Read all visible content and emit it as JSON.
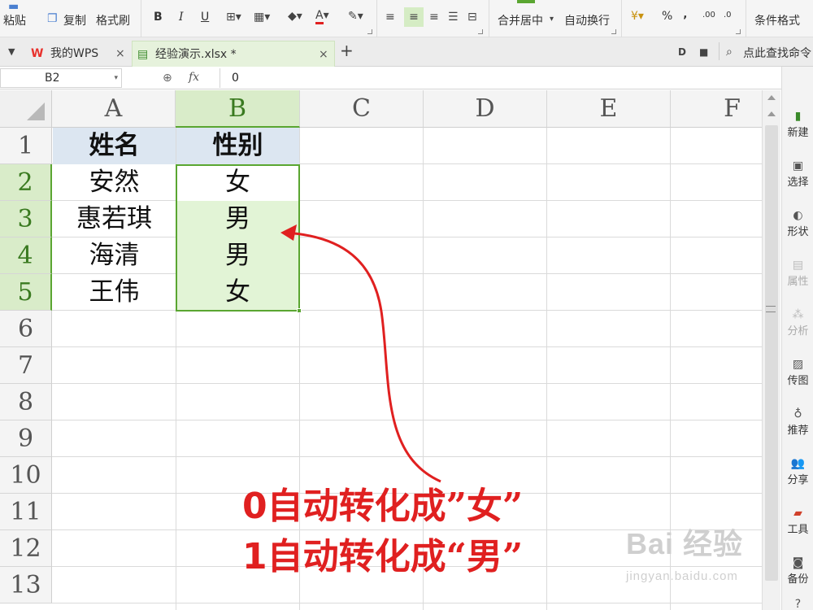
{
  "ribbon": {
    "paste_label": "粘贴",
    "copy_label": "复制",
    "format_painter_label": "格式刷",
    "bold": "B",
    "italic": "I",
    "underline": "U",
    "merge_center_label": "合并居中",
    "wrap_text_label": "自动换行",
    "percent": "%",
    "comma": "‚",
    "decimal_inc": ".00",
    "decimal_dec": ".0",
    "conditional_format_label": "条件格式"
  },
  "tabs": {
    "home_tab": "我的WPS",
    "file_tab": "经验演示.xlsx *",
    "new_tab_icon": "+",
    "search_label": "点此查找命令"
  },
  "formula_bar": {
    "cell_ref": "B2",
    "fx_label": "fx",
    "formula_value": "0"
  },
  "sheet": {
    "columns": [
      "A",
      "B",
      "C",
      "D",
      "E",
      "F"
    ],
    "rows": [
      "1",
      "2",
      "3",
      "4",
      "5",
      "6",
      "7",
      "8",
      "9",
      "10",
      "11",
      "12",
      "13"
    ],
    "header": [
      "姓名",
      "性别"
    ],
    "data": [
      [
        "安然",
        "女"
      ],
      [
        "惠若琪",
        "男"
      ],
      [
        "海清",
        "男"
      ],
      [
        "王伟",
        "女"
      ]
    ],
    "selected_column": "B",
    "selected_rows": [
      "2",
      "3",
      "4",
      "5"
    ]
  },
  "side_panel": {
    "items": [
      "新建",
      "选择",
      "形状",
      "属性",
      "分析",
      "传图",
      "推荐",
      "分享",
      "工具",
      "备份"
    ]
  },
  "annotation": {
    "line1_prefix": "0",
    "line1_text": "自动转化成”女”",
    "line2_prefix": "1",
    "line2_text": "自动转化成“男”",
    "color": "#e02020"
  },
  "watermark": {
    "logo_text": "Bai 经验",
    "url": "jingyan.baidu.com"
  },
  "colors": {
    "selection_green": "#5aa631",
    "selection_fill": "#e2f4d6",
    "header_fill": "#dce6f1",
    "tab_active": "#e6f2dc"
  }
}
